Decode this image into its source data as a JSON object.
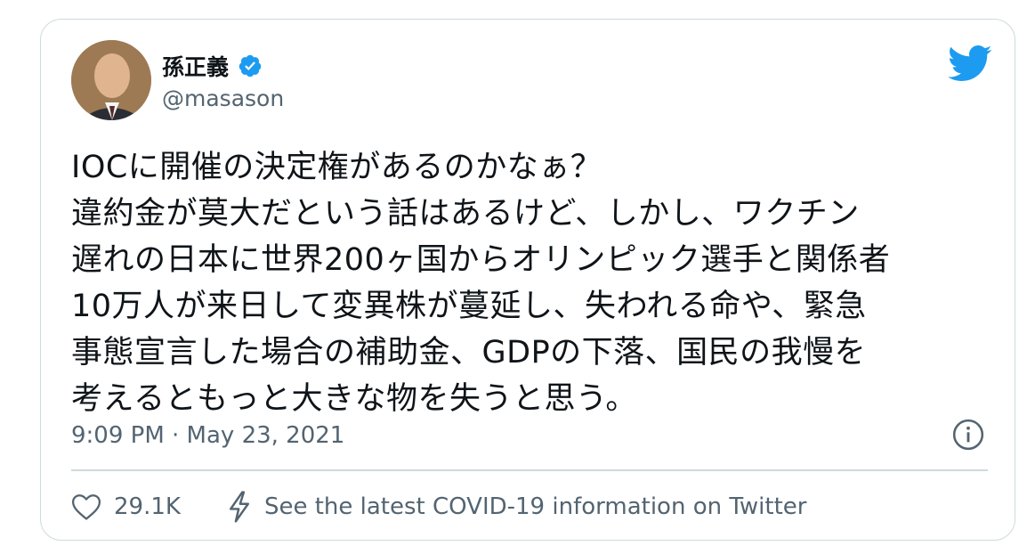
{
  "author": {
    "name": "孫正義",
    "handle": "@masason",
    "verified": true,
    "avatar_icon": "person-avatar"
  },
  "tweet": {
    "text": "IOCに開催の決定権があるのかなぁ？\n違約金が莫大だという話はあるけど、しかし、ワクチン\n遅れの日本に世界200ヶ国からオリンピック選手と関係者\n10万人が来日して変異株が蔓延し、失われる命や、緊急\n事態宣言した場合の補助金、GDPの下落、国民の我慢を\n考えるともっと大きな物を失うと思う。",
    "timestamp": "9:09 PM · May 23, 2021"
  },
  "actions": {
    "like_count": "29.1K",
    "covid_link": "See the latest COVID-19 information on Twitter"
  },
  "icons": {
    "brand": "twitter-bird-icon",
    "verified": "verified-badge-icon",
    "info": "info-icon",
    "like": "heart-icon",
    "covid": "lightning-icon"
  },
  "colors": {
    "brand_blue": "#1d9bf0",
    "secondary_text": "#536471",
    "border": "#cfd9de"
  }
}
